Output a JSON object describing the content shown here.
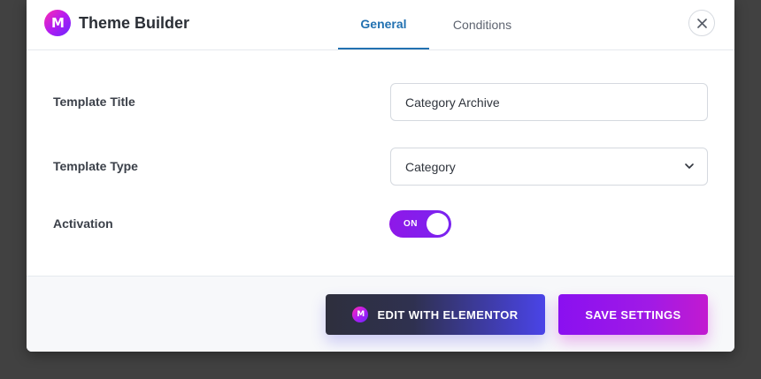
{
  "header": {
    "logo_letter": "M",
    "title": "Theme Builder",
    "tabs": [
      {
        "label": "General",
        "active": true
      },
      {
        "label": "Conditions",
        "active": false
      }
    ],
    "close_icon": "close-icon"
  },
  "form": {
    "template_title": {
      "label": "Template Title",
      "value": "Category Archive"
    },
    "template_type": {
      "label": "Template Type",
      "value": "Category"
    },
    "activation": {
      "label": "Activation",
      "state": "ON"
    }
  },
  "footer": {
    "edit_button": "EDIT WITH ELEMENTOR",
    "save_button": "SAVE SETTINGS"
  },
  "colors": {
    "accent_blue": "#2271b1",
    "toggle_purple": "#8f18e8",
    "save_gradient_start": "#8a10f0",
    "edit_gradient_end": "#4a44e8"
  }
}
